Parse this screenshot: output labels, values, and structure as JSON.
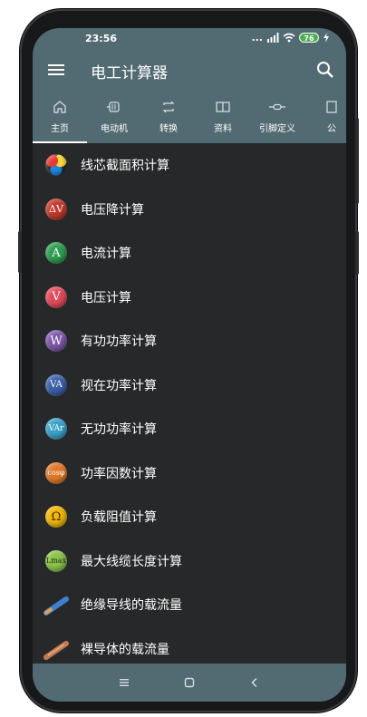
{
  "status_bar": {
    "time": "23:56",
    "network": "...",
    "battery": "76"
  },
  "app_bar": {
    "title": "电工计算器"
  },
  "tabs": [
    {
      "label": "主页",
      "icon": "home-icon",
      "active": true
    },
    {
      "label": "电动机",
      "icon": "motor-icon",
      "active": false
    },
    {
      "label": "转换",
      "icon": "convert-icon",
      "active": false
    },
    {
      "label": "资料",
      "icon": "book-icon",
      "active": false
    },
    {
      "label": "引脚定义",
      "icon": "connector-icon",
      "active": false
    },
    {
      "label": "公",
      "icon": "formula-icon",
      "active": false
    }
  ],
  "list": [
    {
      "label": "线芯截面积计算",
      "badge": "",
      "color": "#2f6fb5"
    },
    {
      "label": "电压降计算",
      "badge": "ΔV",
      "color": "#c0392b"
    },
    {
      "label": "电流计算",
      "badge": "A",
      "color": "#2e9e4f"
    },
    {
      "label": "电压计算",
      "badge": "V",
      "color": "#e04a5a"
    },
    {
      "label": "有功功率计算",
      "badge": "W",
      "color": "#7e57a8"
    },
    {
      "label": "视在功率计算",
      "badge": "VA",
      "color": "#3b5fa8"
    },
    {
      "label": "无功功率计算",
      "badge": "VAr",
      "color": "#3aa0c8"
    },
    {
      "label": "功率因数计算",
      "badge": "cosφ",
      "color": "#e0782a"
    },
    {
      "label": "负载阻值计算",
      "badge": "Ω",
      "color": "#f2b705"
    },
    {
      "label": "最大线缆长度计算",
      "badge": "Lmax",
      "color": "#8bc34a"
    },
    {
      "label": "绝缘导线的载流量",
      "badge": "",
      "color": "#3f7fd0"
    },
    {
      "label": "裸导体的载流量",
      "badge": "",
      "color": "#c07a50"
    }
  ],
  "colors": {
    "primary": "#526a71",
    "background": "#262829"
  }
}
